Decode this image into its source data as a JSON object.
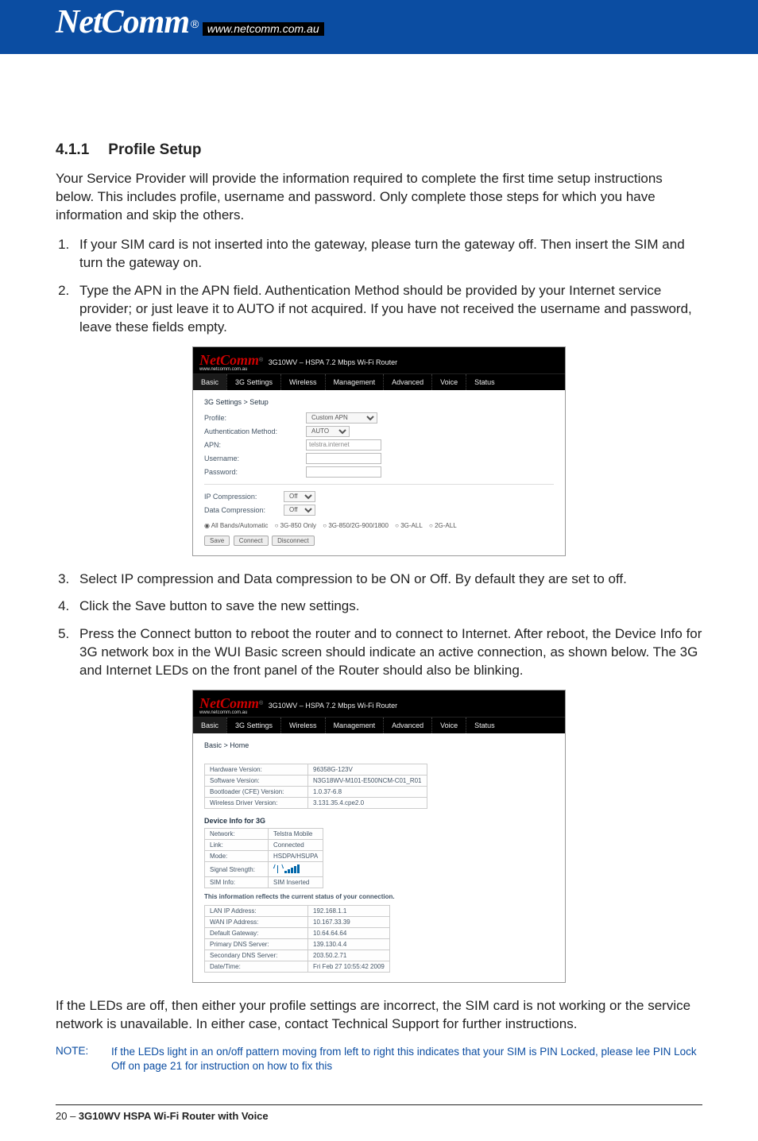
{
  "header": {
    "brand": "NetComm",
    "registered": "®",
    "url": "www.netcomm.com.au"
  },
  "section": {
    "number": "4.1.1",
    "title": "Profile Setup"
  },
  "intro": "Your Service Provider will provide the information required to complete the first time setup instructions below. This includes profile, username and password. Only complete those steps for which you have information and skip the others.",
  "steps_a": [
    "If your SIM card is not inserted into the gateway, please turn the gateway off. Then insert the SIM and turn the gateway on.",
    "Type the APN in the APN field. Authentication Method should be provided by your Internet service provider; or just leave it to AUTO if not acquired. If you have not received the username and password, leave these fields empty."
  ],
  "steps_b": [
    "Select IP compression and Data compression to be ON or Off. By default they are set to off.",
    "Click the Save button to save the new settings.",
    "Press the Connect button to reboot the router and to connect to Internet. After reboot, the Device Info for 3G network box in the WUI Basic screen should indicate an active connection, as shown below. The 3G and Internet LEDs on the front panel of the Router should also be blinking."
  ],
  "shot1": {
    "brand": "NetComm",
    "sub": "www.netcomm.com.au",
    "title": "3G10WV – HSPA 7.2 Mbps Wi-Fi Router",
    "tabs": [
      "Basic",
      "3G Settings",
      "Wireless",
      "Management",
      "Advanced",
      "Voice",
      "Status"
    ],
    "crumb": "3G Settings > Setup",
    "fields": {
      "profile_l": "Profile:",
      "profile_v": "Custom APN",
      "auth_l": "Authentication Method:",
      "auth_v": "AUTO",
      "apn_l": "APN:",
      "apn_v": "telstra.internet",
      "user_l": "Username:",
      "pass_l": "Password:",
      "ipc_l": "IP Compression:",
      "ipc_v": "Off",
      "dc_l": "Data Compression:",
      "dc_v": "Off"
    },
    "radios": [
      "All Bands/Automatic",
      "3G-850 Only",
      "3G-850/2G-900/1800",
      "3G-ALL",
      "2G-ALL"
    ],
    "buttons": [
      "Save",
      "Connect",
      "Disconnect"
    ]
  },
  "shot2": {
    "brand": "NetComm",
    "sub": "www.netcomm.com.au",
    "title": "3G10WV – HSPA 7.2 Mbps Wi-Fi Router",
    "tabs": [
      "Basic",
      "3G Settings",
      "Wireless",
      "Management",
      "Advanced",
      "Voice",
      "Status"
    ],
    "crumb": "Basic > Home",
    "hw": [
      [
        "Hardware Version:",
        "96358G-123V"
      ],
      [
        "Software Version:",
        "N3G18WV-M101-E500NCM-C01_R01"
      ],
      [
        "Bootloader (CFE) Version:",
        "1.0.37-6.8"
      ],
      [
        "Wireless Driver Version:",
        "3.131.35.4.cpe2.0"
      ]
    ],
    "dev_head": "Device Info for 3G",
    "dev": [
      [
        "Network:",
        "Telstra Mobile"
      ],
      [
        "Link:",
        "Connected"
      ],
      [
        "Mode:",
        "HSDPA/HSUPA"
      ],
      [
        "Signal Strength:",
        "__SIGNAL__"
      ],
      [
        "SIM Info:",
        "SIM Inserted"
      ]
    ],
    "info_note": "This information reflects the current status of your connection.",
    "conn": [
      [
        "LAN IP Address:",
        "192.168.1.1"
      ],
      [
        "WAN IP Address:",
        "10.167.33.39"
      ],
      [
        "Default Gateway:",
        "10.64.64.64"
      ],
      [
        "Primary DNS Server:",
        "139.130.4.4"
      ],
      [
        "Secondary DNS Server:",
        "203.50.2.71"
      ],
      [
        "Date/Time:",
        "Fri Feb 27 10:55:42 2009"
      ]
    ]
  },
  "outro": "If the LEDs are off, then either your profile settings are incorrect, the SIM card is not working or the service network is unavailable. In either case, contact Technical Support for further instructions.",
  "note": {
    "label": "NOTE:",
    "text": "If the LEDs light in an on/off pattern moving from left to right this indicates that your SIM is PIN Locked, please lee PIN Lock Off on page 21 for instruction on how to fix this"
  },
  "footer": {
    "page": "20 – ",
    "product": "3G10WV HSPA Wi-Fi Router with Voice"
  }
}
